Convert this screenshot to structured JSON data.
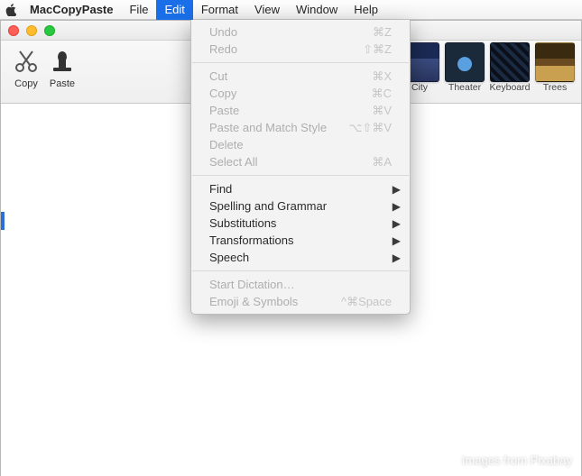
{
  "menubar": {
    "app_name": "MacCopyPaste",
    "items": [
      "File",
      "Edit",
      "Format",
      "View",
      "Window",
      "Help"
    ],
    "active_index": 1
  },
  "toolbar": {
    "copy_label": "Copy",
    "paste_label": "Paste"
  },
  "images": [
    {
      "label": "City",
      "class": "city"
    },
    {
      "label": "Theater",
      "class": "theater"
    },
    {
      "label": "Keyboard",
      "class": "keyboard"
    },
    {
      "label": "Trees",
      "class": "trees"
    }
  ],
  "edit_menu": {
    "sections": [
      [
        {
          "label": "Undo",
          "short": "⌘Z",
          "disabled": true
        },
        {
          "label": "Redo",
          "short": "⇧⌘Z",
          "disabled": true
        }
      ],
      [
        {
          "label": "Cut",
          "short": "⌘X",
          "disabled": true
        },
        {
          "label": "Copy",
          "short": "⌘C",
          "disabled": true
        },
        {
          "label": "Paste",
          "short": "⌘V",
          "disabled": true
        },
        {
          "label": "Paste and Match Style",
          "short": "⌥⇧⌘V",
          "disabled": true
        },
        {
          "label": "Delete",
          "short": "",
          "disabled": true
        },
        {
          "label": "Select All",
          "short": "⌘A",
          "disabled": true
        }
      ],
      [
        {
          "label": "Find",
          "submenu": true,
          "disabled": false
        },
        {
          "label": "Spelling and Grammar",
          "submenu": true,
          "disabled": false
        },
        {
          "label": "Substitutions",
          "submenu": true,
          "disabled": false
        },
        {
          "label": "Transformations",
          "submenu": true,
          "disabled": false
        },
        {
          "label": "Speech",
          "submenu": true,
          "disabled": false
        }
      ],
      [
        {
          "label": "Start Dictation…",
          "short": "",
          "disabled": true
        },
        {
          "label": "Emoji & Symbols",
          "short": "^⌘Space",
          "disabled": true
        }
      ]
    ]
  },
  "watermark": "Images from Pixabay"
}
